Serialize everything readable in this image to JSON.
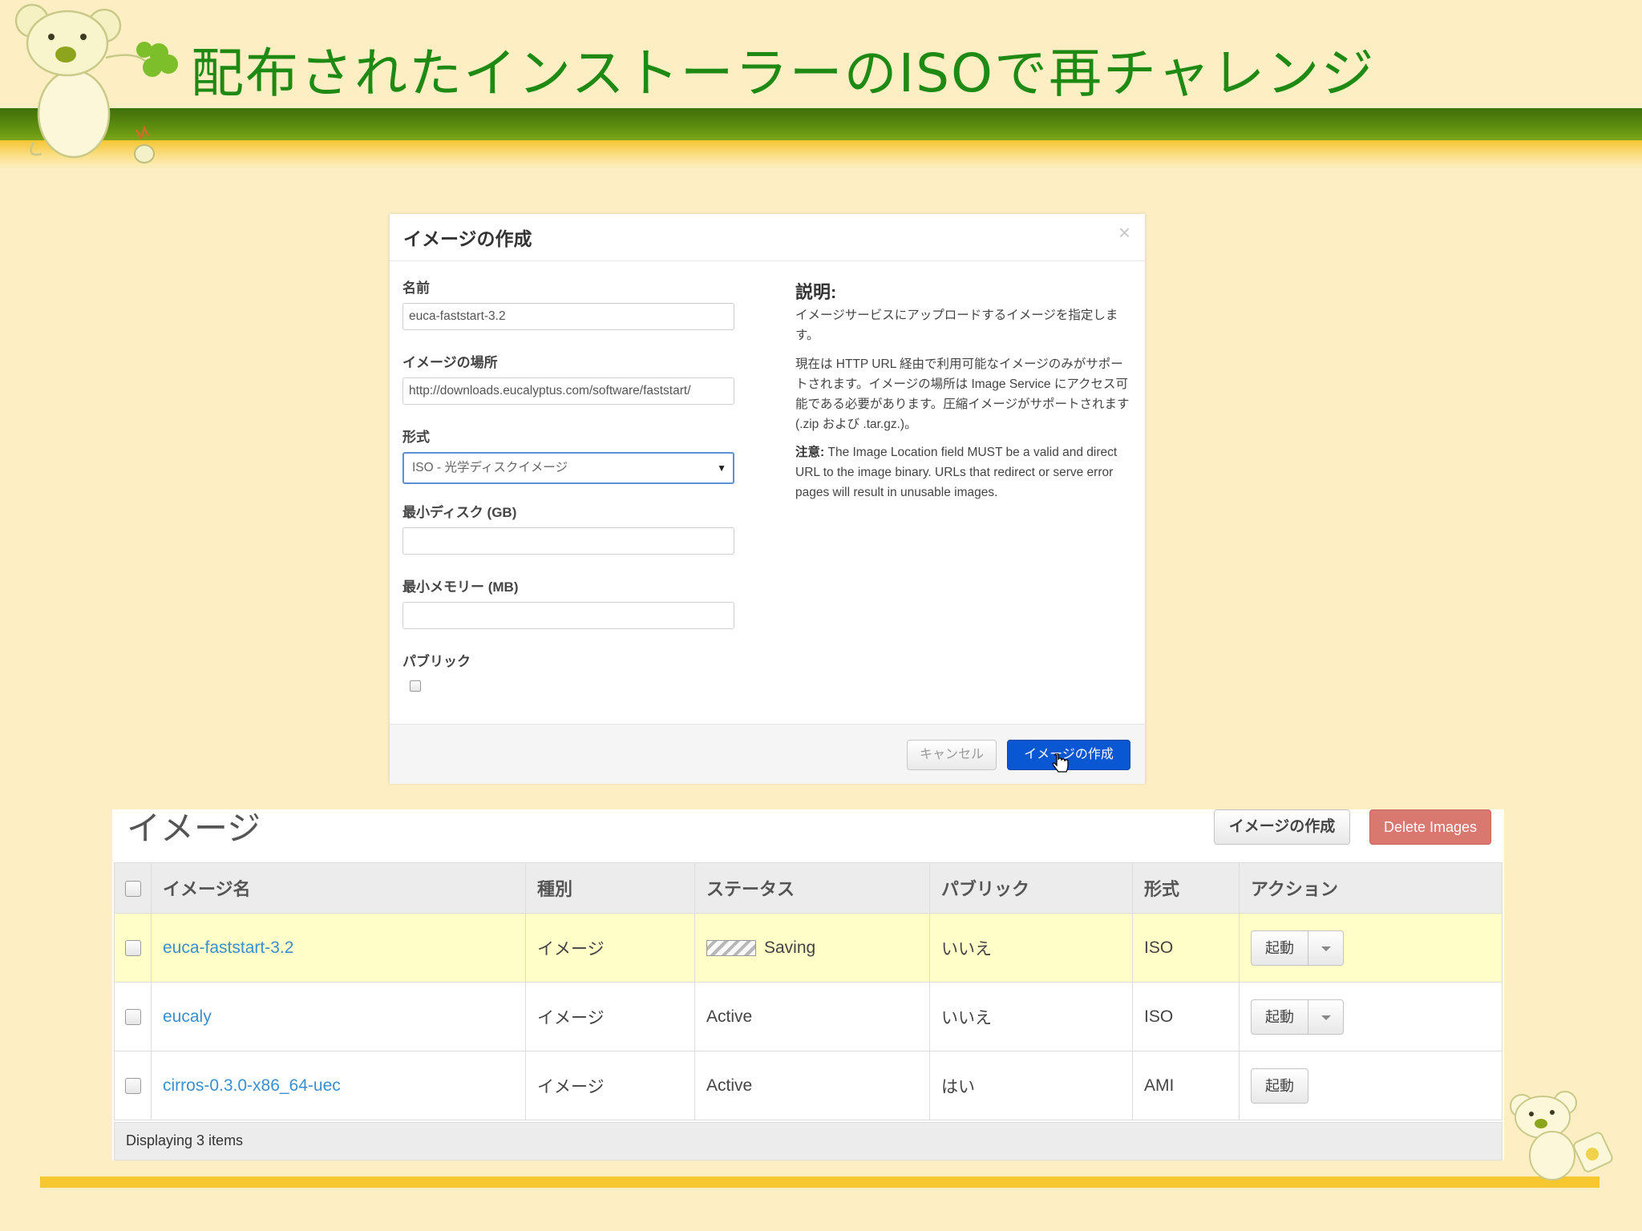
{
  "slide": {
    "title": "配布されたインストーラーのISOで再チャレンジ"
  },
  "modal": {
    "title": "イメージの作成",
    "close": "×",
    "fields": {
      "name": {
        "label": "名前",
        "value": "euca-faststart-3.2"
      },
      "location": {
        "label": "イメージの場所",
        "value": "http://downloads.eucalyptus.com/software/faststart/"
      },
      "format": {
        "label": "形式",
        "value": "ISO - 光学ディスクイメージ"
      },
      "min_disk": {
        "label": "最小ディスク (GB)",
        "value": ""
      },
      "min_memory": {
        "label": "最小メモリー (MB)",
        "value": ""
      },
      "public": {
        "label": "パブリック"
      }
    },
    "description": {
      "heading": "説明:",
      "p1": "イメージサービスにアップロードするイメージを指定します。",
      "p2": "現在は HTTP URL 経由で利用可能なイメージのみがサポートされます。イメージの場所は Image Service にアクセス可能である必要があります。圧縮イメージがサポートされます (.zip および .tar.gz.)。",
      "note_label": "注意:",
      "note_text": " The Image Location field MUST be a valid and direct URL to the image binary. URLs that redirect or serve error pages will result in unusable images."
    },
    "buttons": {
      "cancel": "キャンセル",
      "create": "イメージの作成"
    }
  },
  "panel": {
    "title": "イメージ",
    "create_button": "イメージの作成",
    "delete_button": "Delete Images",
    "columns": [
      "イメージ名",
      "種別",
      "ステータス",
      "パブリック",
      "形式",
      "アクション"
    ],
    "rows": [
      {
        "name": "euca-faststart-3.2",
        "type": "イメージ",
        "status": "Saving",
        "public": "いいえ",
        "format": "ISO",
        "action": "起動"
      },
      {
        "name": "eucaly",
        "type": "イメージ",
        "status": "Active",
        "public": "いいえ",
        "format": "ISO",
        "action": "起動"
      },
      {
        "name": "cirros-0.3.0-x86_64-uec",
        "type": "イメージ",
        "status": "Active",
        "public": "はい",
        "format": "AMI",
        "action": "起動"
      }
    ],
    "footer": "Displaying 3 items"
  },
  "colors": {
    "background": "#fdefc3",
    "title_green": "#1e8a14",
    "band_green": "#4a7a0c",
    "band_yellow": "#f7c72f",
    "primary_blue": "#0a57d3",
    "delete_red": "#d9786f",
    "link_blue": "#3c8fce",
    "highlight_row": "#fffdc8"
  },
  "icons": [
    "koala-mascot-icon",
    "clover-icon",
    "koala-small-icon",
    "hand-cursor-icon",
    "close-icon",
    "chevron-down-icon"
  ]
}
